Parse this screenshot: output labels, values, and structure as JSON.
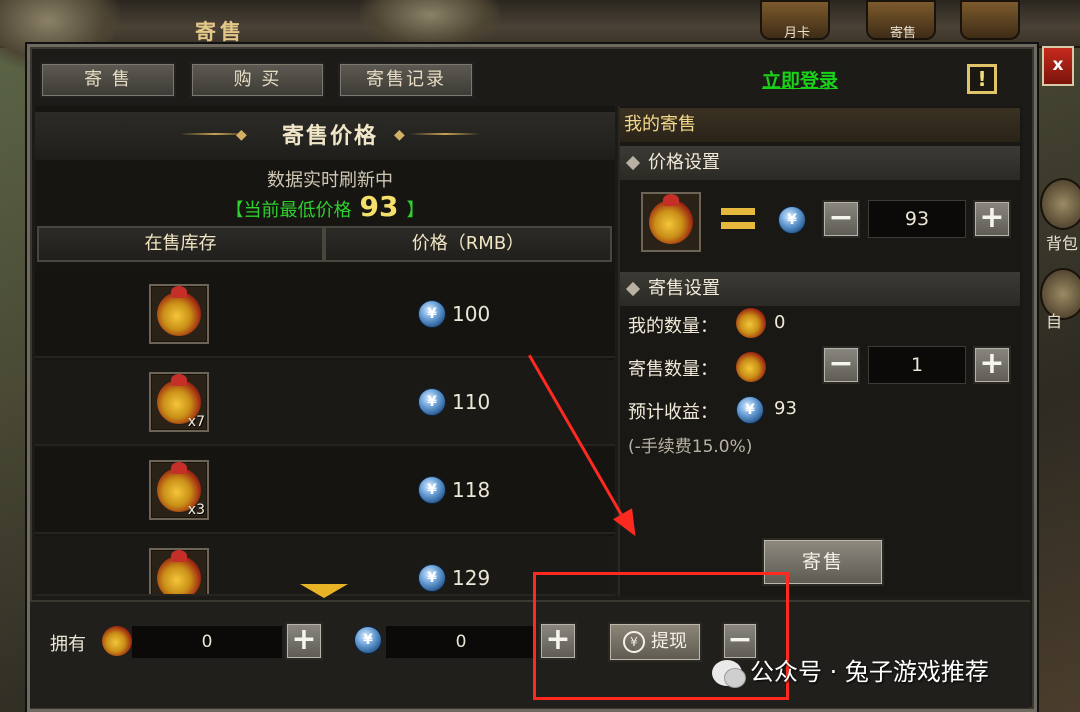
{
  "window": {
    "title": "寄售"
  },
  "hud": {
    "items": [
      {
        "label": "月卡"
      },
      {
        "label": "寄售"
      }
    ],
    "right": [
      {
        "label": "背包"
      },
      {
        "label": "自"
      }
    ]
  },
  "tabs": [
    {
      "label": "寄 售"
    },
    {
      "label": "购 买"
    },
    {
      "label": "寄售记录"
    }
  ],
  "login_link": "立即登录",
  "info_label": "!",
  "close_label": "x",
  "market": {
    "title": "寄售价格",
    "refresh_text": "数据实时刷新中",
    "lowest_label": "当前最低价格",
    "lowest_open": "【",
    "lowest_close": "】",
    "lowest_value": "93",
    "columns": [
      "在售库存",
      "价格（RMB）"
    ],
    "rows": [
      {
        "qty": "",
        "price": "100"
      },
      {
        "qty": "x7",
        "price": "110"
      },
      {
        "qty": "x3",
        "price": "118"
      },
      {
        "qty": "",
        "price": "129"
      }
    ],
    "coin_symbol": "¥"
  },
  "my_consign": {
    "title": "我的寄售",
    "price_settings": {
      "title": "价格设置",
      "price_value": "93",
      "minus_label": "−",
      "plus_label": "+"
    },
    "sale_settings": {
      "title": "寄售设置",
      "my_qty_label": "我的数量：",
      "my_qty_value": "0",
      "sell_qty_label": "寄售数量：",
      "sell_qty_value": "1",
      "income_label": "预计收益：",
      "income_value": "93",
      "fee_note": "(-手续费15.0%)"
    },
    "consign_button": "寄售"
  },
  "bottom": {
    "own_label": "拥有",
    "bag_amount": "0",
    "coin_amount": "0",
    "plus_label": "+",
    "minus_label": "−",
    "withdraw_label": "提现",
    "withdraw_icon": "¥"
  },
  "watermark": "公众号 · 兔子游戏推荐",
  "colors": {
    "accent_green": "#19d318",
    "gold": "#e6b93c",
    "annotation_red": "#ff2a1f"
  }
}
